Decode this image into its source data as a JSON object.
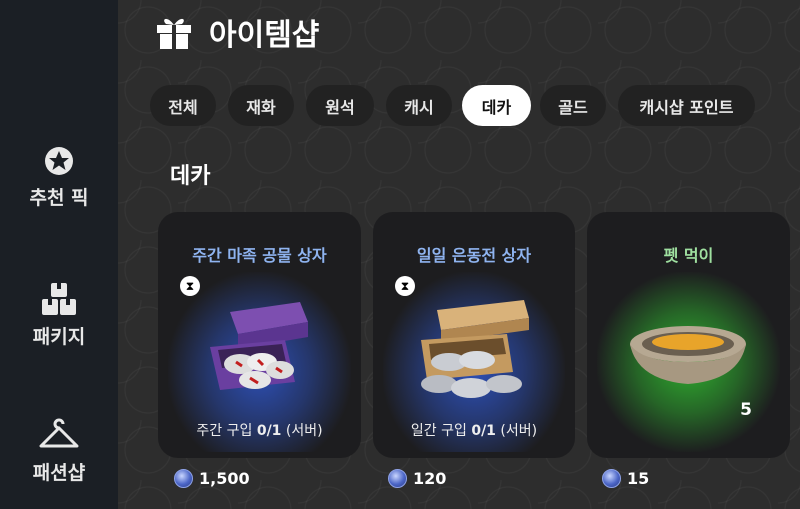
{
  "header": {
    "title": "아이템샵",
    "icon": "gift-icon"
  },
  "sidebar": {
    "items": [
      {
        "label": "추천 픽",
        "icon": "star-badge-icon"
      },
      {
        "label": "패키지",
        "icon": "package-icon"
      },
      {
        "label": "패션샵",
        "icon": "hanger-icon"
      }
    ]
  },
  "tabs": [
    {
      "label": "전체",
      "active": false
    },
    {
      "label": "재화",
      "active": false
    },
    {
      "label": "원석",
      "active": false
    },
    {
      "label": "캐시",
      "active": false
    },
    {
      "label": "데카",
      "active": true
    },
    {
      "label": "골드",
      "active": false
    },
    {
      "label": "캐시샵 포인트",
      "active": false
    }
  ],
  "section": {
    "title": "데카"
  },
  "products": [
    {
      "name": "주간 마족 공물 상자",
      "name_color": "#8fb4f0",
      "glow_color": "#2d4fb5",
      "limit_prefix": "주간 구입 ",
      "limit_count": "0/1",
      "limit_suffix": " (서버)",
      "price": "1,500",
      "timed": true
    },
    {
      "name": "일일 은동전 상자",
      "name_color": "#8fb4f0",
      "glow_color": "#2d4fb5",
      "limit_prefix": "일간 구입 ",
      "limit_count": "0/1",
      "limit_suffix": " (서버)",
      "price": "120",
      "timed": true
    },
    {
      "name": "펫 먹이",
      "name_color": "#9fe0a0",
      "glow_color": "#2fae2f",
      "quantity": "5",
      "price": "15",
      "timed": false
    }
  ],
  "colors": {
    "accent": "#ffffff",
    "sidebar_bg": "#1b1f25",
    "card_bg": "#1d1d1f"
  }
}
